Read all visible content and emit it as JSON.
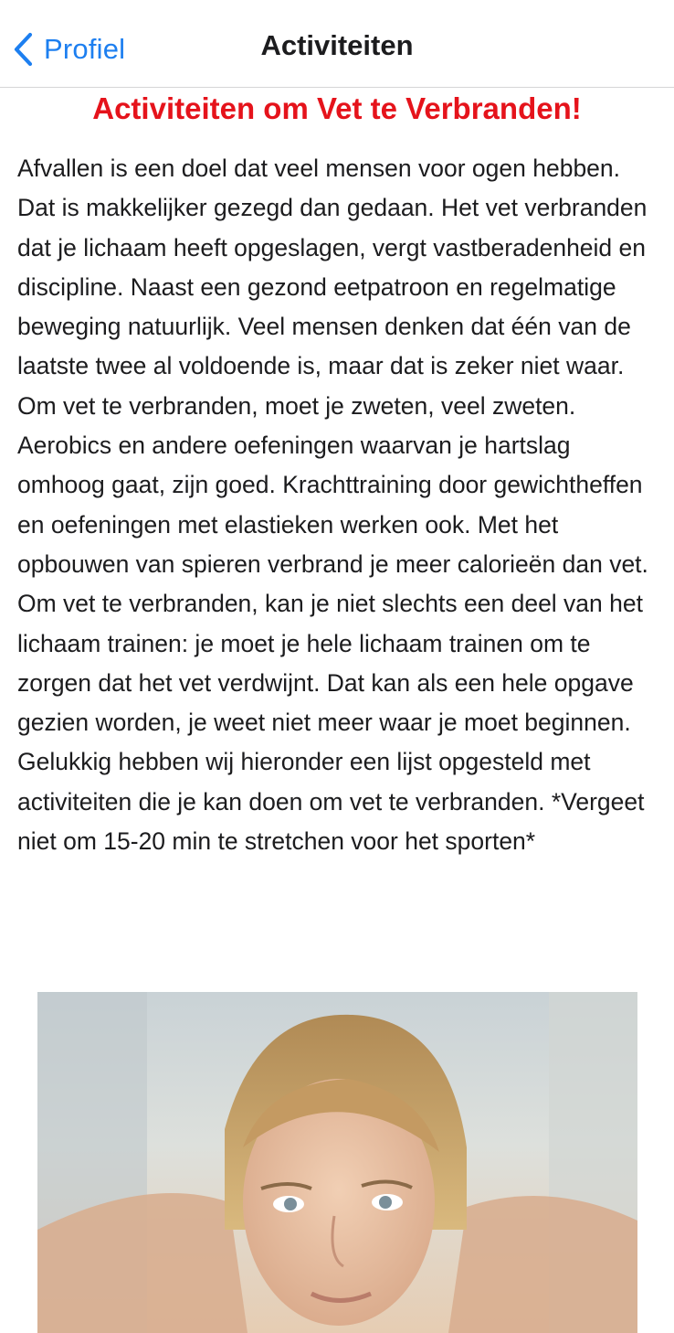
{
  "navbar": {
    "back_label": "Profiel",
    "title": "Activiteiten"
  },
  "article": {
    "heading": "Activiteiten om Vet te Verbranden!",
    "body": "Afvallen is een doel dat veel mensen voor ogen hebben. Dat is makkelijker gezegd dan gedaan. Het vet verbranden dat je lichaam heeft opgeslagen, vergt vastberadenheid en discipline. Naast een gezond eetpatroon en regelmatige beweging natuurlijk. Veel mensen denken dat één van de laatste twee al voldoende is, maar dat is zeker niet waar. Om vet te verbranden, moet je zweten, veel zweten. Aerobics en andere oefeningen waarvan je hartslag omhoog gaat, zijn goed. Krachttraining door gewichtheffen en oefeningen met elastieken werken ook. Met het opbouwen van spieren verbrand je meer calorieën dan vet. Om vet te verbranden, kan je niet slechts een deel van het lichaam trainen: je moet je hele lichaam trainen om te zorgen dat het vet verdwijnt. Dat kan als een hele opgave gezien worden, je weet niet meer waar je moet beginnen. Gelukkig hebben wij hieronder een lijst opgesteld met activiteiten die je kan doen om vet te verbranden. *Vergeet niet om 15-20 min te stretchen voor het sporten*"
  },
  "colors": {
    "accent": "#1d7ff0",
    "heading": "#e5131b",
    "text": "#1c1c1e"
  },
  "icons": {
    "back": "chevron-left-icon"
  }
}
